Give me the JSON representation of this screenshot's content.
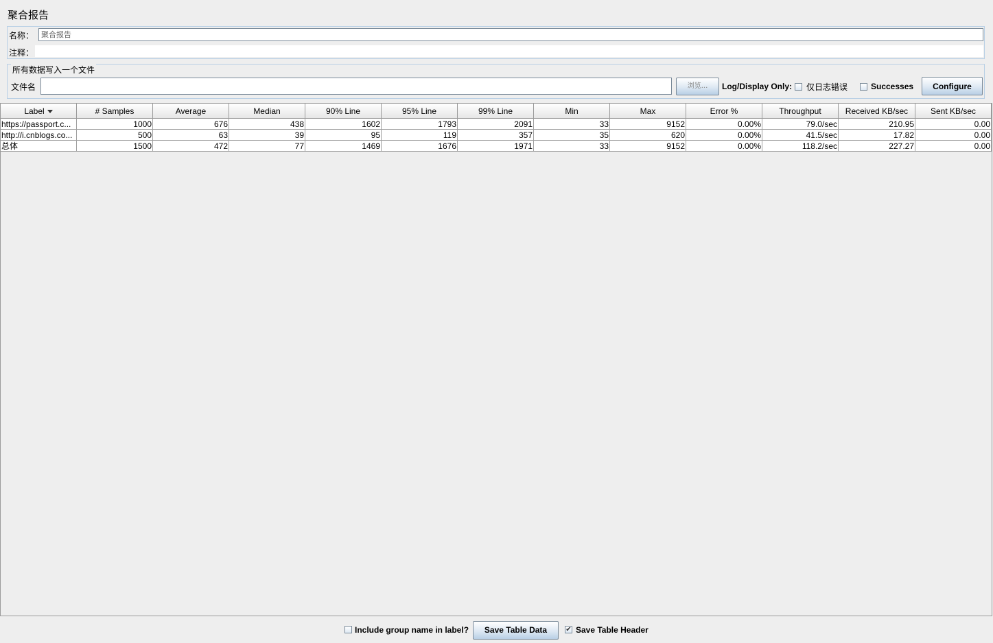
{
  "title": "聚合报告",
  "name_field": {
    "label": "名称：",
    "value": "聚合报告"
  },
  "comment_field": {
    "label": "注释：",
    "value": ""
  },
  "file_panel": {
    "legend": "所有数据写入一个文件",
    "filename_label": "文件名",
    "filename_value": "",
    "browse_label": "浏览...",
    "log_display_label": "Log/Display Only:",
    "errors_label": "仅日志错误",
    "errors_checked": false,
    "successes_label": "Successes",
    "successes_checked": false,
    "configure_label": "Configure"
  },
  "table": {
    "columns": [
      "Label",
      "# Samples",
      "Average",
      "Median",
      "90% Line",
      "95% Line",
      "99% Line",
      "Min",
      "Max",
      "Error %",
      "Throughput",
      "Received KB/sec",
      "Sent KB/sec"
    ],
    "sorted_column": "Label",
    "rows": [
      [
        "https://passport.c...",
        "1000",
        "676",
        "438",
        "1602",
        "1793",
        "2091",
        "33",
        "9152",
        "0.00%",
        "79.0/sec",
        "210.95",
        "0.00"
      ],
      [
        "http://i.cnblogs.co...",
        "500",
        "63",
        "39",
        "95",
        "119",
        "357",
        "35",
        "620",
        "0.00%",
        "41.5/sec",
        "17.82",
        "0.00"
      ],
      [
        "总体",
        "1500",
        "472",
        "77",
        "1469",
        "1676",
        "1971",
        "33",
        "9152",
        "0.00%",
        "118.2/sec",
        "227.27",
        "0.00"
      ]
    ]
  },
  "footer": {
    "include_group_label": "Include group name in label?",
    "include_group_checked": false,
    "save_table_data_label": "Save Table Data",
    "save_header_label": "Save Table Header",
    "save_header_checked": true
  }
}
